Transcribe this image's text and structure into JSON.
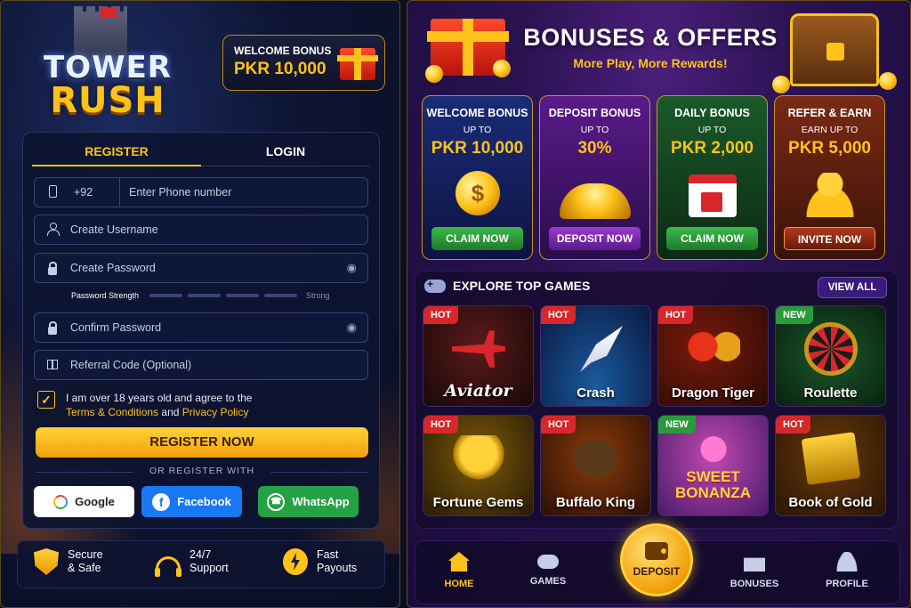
{
  "brand": {
    "line1": "TOWER",
    "line2": "RUSH"
  },
  "welcome_bonus": {
    "title": "WELCOME BONUS",
    "amount": "PKR 10,000"
  },
  "auth_tabs": {
    "register": "REGISTER",
    "login": "LOGIN",
    "active": "register"
  },
  "form": {
    "country_code": "+92",
    "phone_placeholder": "Enter Phone number",
    "username_placeholder": "Create Username",
    "password_placeholder": "Create Password",
    "strength_label": "Password Strength",
    "strength_value": "Strong",
    "confirm_placeholder": "Confirm Password",
    "referral_placeholder": "Referral Code (Optional)",
    "agree_text": "I am over 18 years old and agree to the",
    "terms_link": "Terms & Conditions",
    "and_text": "and",
    "privacy_link": "Privacy Policy",
    "agree_checked": true,
    "register_button": "REGISTER NOW",
    "or_register_with": "OR REGISTER WITH",
    "social": {
      "google": "Google",
      "facebook": "Facebook",
      "whatsapp": "WhatsApp"
    }
  },
  "trust": [
    {
      "line1": "Secure",
      "line2": "& Safe",
      "icon": "shield-icon"
    },
    {
      "line1": "24/7",
      "line2": "Support",
      "icon": "headset-icon"
    },
    {
      "line1": "Fast",
      "line2": "Payouts",
      "icon": "lightning-icon"
    }
  ],
  "offers_header": {
    "title": "BONUSES & OFFERS",
    "subtitle": "More Play, More Rewards!"
  },
  "bonus_cards": [
    {
      "title": "WELCOME BONUS",
      "upto": "UP TO",
      "value": "PKR 10,000",
      "button": "CLAIM NOW"
    },
    {
      "title": "DEPOSIT BONUS",
      "upto": "UP TO",
      "value": "30%",
      "button": "DEPOSIT NOW"
    },
    {
      "title": "DAILY BONUS",
      "upto": "UP TO",
      "value": "PKR 2,000",
      "button": "CLAIM NOW"
    },
    {
      "title": "REFER & EARN",
      "upto": "EARN UP TO",
      "value": "PKR 5,000",
      "button": "INVITE NOW"
    }
  ],
  "games_section": {
    "title": "EXPLORE TOP GAMES",
    "view_all": "VIEW ALL"
  },
  "games": [
    {
      "name": "Aviator",
      "badge": "HOT"
    },
    {
      "name": "Crash",
      "badge": "HOT"
    },
    {
      "name": "Dragon Tiger",
      "badge": "HOT"
    },
    {
      "name": "Roulette",
      "badge": "NEW"
    },
    {
      "name": "Fortune Gems",
      "badge": "HOT"
    },
    {
      "name": "Buffalo King",
      "badge": "HOT"
    },
    {
      "name": "Sweet Bonanza",
      "logo_line1": "SWEET",
      "logo_line2": "BONANZA",
      "badge": "NEW"
    },
    {
      "name": "Book of Gold",
      "badge": "HOT"
    }
  ],
  "bottom_nav": {
    "home": "HOME",
    "games": "GAMES",
    "deposit": "DEPOSIT",
    "bonuses": "BONUSES",
    "profile": "PROFILE",
    "active": "home"
  },
  "colors": {
    "accent": "#ffc21a",
    "hot": "#d8262b",
    "new": "#2a9a3a",
    "claim_green": "#3cb84a"
  }
}
